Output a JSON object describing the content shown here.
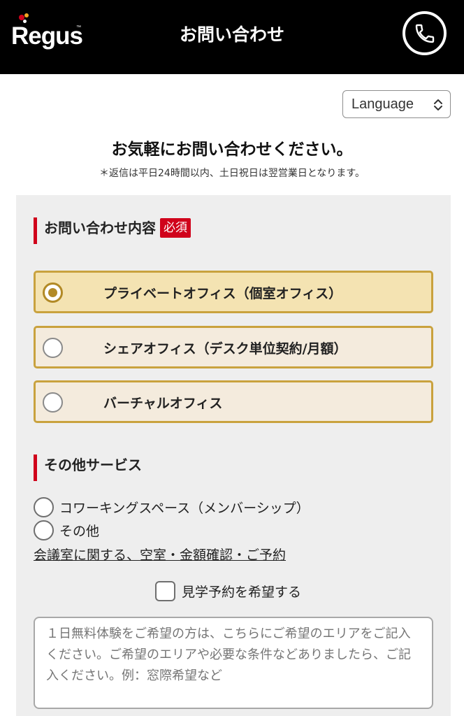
{
  "header": {
    "logo_text": "Regus",
    "logo_tm": "™",
    "title": "お問い合わせ",
    "phone_icon": "phone-icon",
    "logo_dot_colors": [
      "#d0021b",
      "#f5a623",
      "#ffffff"
    ]
  },
  "language": {
    "label": "Language",
    "icon": "chevron-updown-icon"
  },
  "intro": {
    "title": "お気軽にお問い合わせください。",
    "note": "＊返信は平日24時間以内、土日祝日は翌営業日となります。"
  },
  "inquiry": {
    "heading": "お問い合わせ内容",
    "required": "必須",
    "options": [
      {
        "label": "プライベートオフィス（個室オフィス）",
        "selected": true
      },
      {
        "label": "シェアオフィス（デスク単位契約/月額）",
        "selected": false
      },
      {
        "label": "バーチャルオフィス",
        "selected": false
      }
    ]
  },
  "other_services": {
    "heading": "その他サービス",
    "options": [
      {
        "label": "コワーキングスペース（メンバーシップ）",
        "selected": false
      },
      {
        "label": "その他",
        "selected": false
      }
    ],
    "meeting_link": "会議室に関する、空室・金額確認・ご予約"
  },
  "tour": {
    "label": "見学予約を希望する",
    "checked": false
  },
  "message": {
    "placeholder": "１日無料体験をご希望の方は、こちらにご希望のエリアをご記入ください。ご希望のエリアや必要な条件などありましたら、ご記入ください。例：窓際希望など"
  },
  "colors": {
    "header_bg": "#000000",
    "accent_red": "#d0021b",
    "card_border": "#c9a23e",
    "card_bg": "#f4ebdd",
    "card_selected_bg": "#f4e3b2",
    "panel_bg": "#eeeeee"
  }
}
